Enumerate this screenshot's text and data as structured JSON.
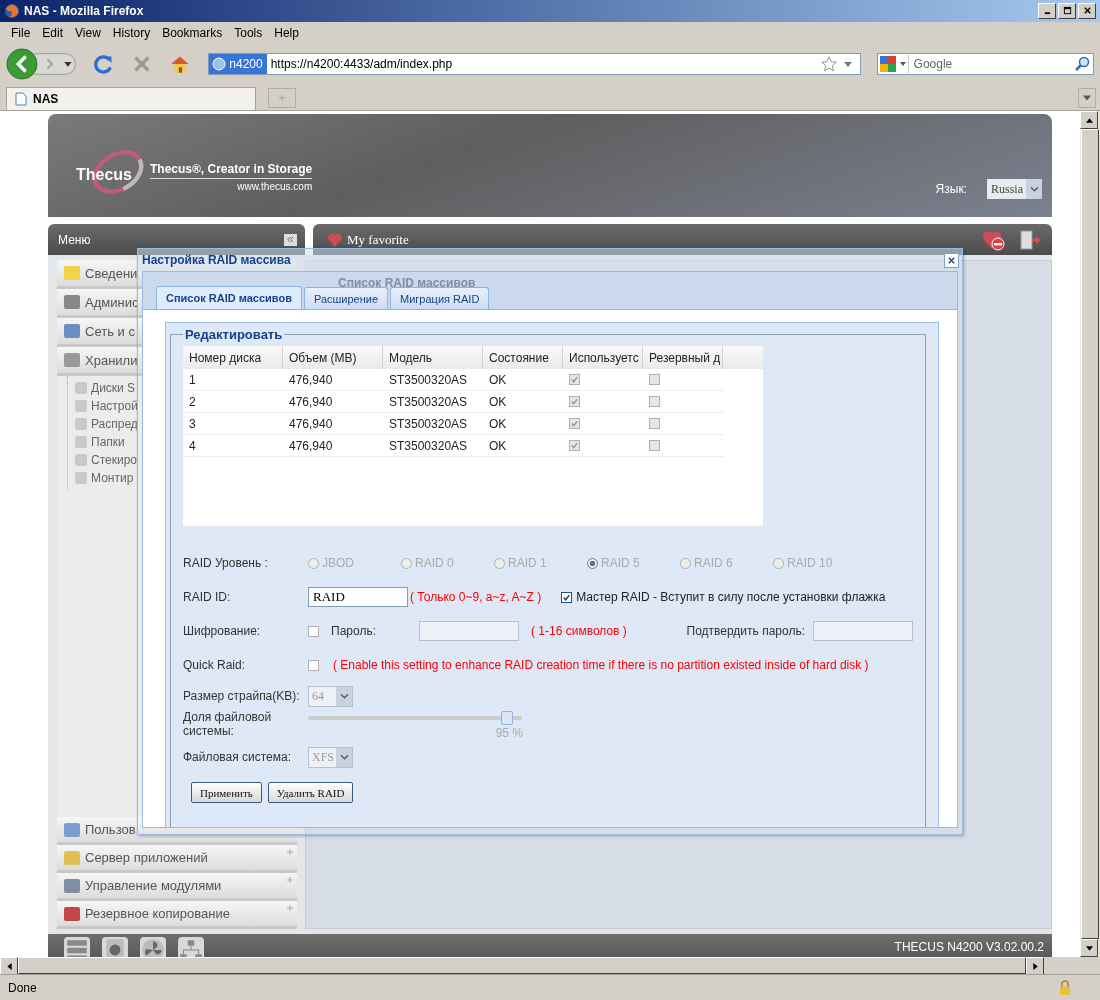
{
  "browser": {
    "title": "NAS - Mozilla Firefox",
    "menu": [
      "File",
      "Edit",
      "View",
      "History",
      "Bookmarks",
      "Tools",
      "Help"
    ],
    "site_badge": "n4200",
    "url": "https://n4200:4433/adm/index.php",
    "search_placeholder": "Google",
    "tabs": [
      {
        "label": "NAS",
        "selected": true
      }
    ],
    "status": "Done"
  },
  "header": {
    "logo": "Thecus",
    "tagline": "Thecus®, Creator in Storage",
    "website": "www.thecus.com",
    "language_label": "Язык:",
    "language": "Russia"
  },
  "menu_bar": {
    "title": "Меню"
  },
  "favorite_bar": {
    "title": "My favorite"
  },
  "sidebar": {
    "upper": [
      {
        "label": "Сведени"
      },
      {
        "label": "Админис"
      },
      {
        "label": "Сеть и с"
      },
      {
        "label": "Хранили",
        "children": [
          "Диски S",
          "Настрой",
          "Распред",
          "Папки",
          "Стекиро",
          "Монтир"
        ]
      }
    ],
    "lower": [
      {
        "label": "Пользов"
      },
      {
        "label": "Сервер приложений"
      },
      {
        "label": "Управление модулями"
      },
      {
        "label": "Резервное копирование"
      }
    ]
  },
  "background_panel": {
    "title": "Список RAID массивов"
  },
  "dialog": {
    "title": "Настройка RAID массива",
    "tabs": [
      {
        "label": "Список RAID массивов",
        "selected": true
      },
      {
        "label": "Расширение",
        "selected": false
      },
      {
        "label": "Миграция RAID",
        "selected": false
      }
    ],
    "legend": "Редактировать",
    "disk_table": {
      "columns": [
        "Номер диска",
        "Объем (MB)",
        "Модель",
        "Состояние",
        "Используетс",
        "Резервный д"
      ],
      "rows": [
        {
          "cells": [
            "1",
            "476,940",
            "ST3500320AS",
            "OK"
          ],
          "used": true,
          "spare": false
        },
        {
          "cells": [
            "2",
            "476,940",
            "ST3500320AS",
            "OK"
          ],
          "used": true,
          "spare": false
        },
        {
          "cells": [
            "3",
            "476,940",
            "ST3500320AS",
            "OK"
          ],
          "used": true,
          "spare": false
        },
        {
          "cells": [
            "4",
            "476,940",
            "ST3500320AS",
            "OK"
          ],
          "used": true,
          "spare": false
        }
      ]
    },
    "raid_level": {
      "label": "RAID Уровень :",
      "options": [
        {
          "label": "JBOD",
          "selected": false
        },
        {
          "label": "RAID 0",
          "selected": false
        },
        {
          "label": "RAID 1",
          "selected": false
        },
        {
          "label": "RAID 5",
          "selected": true
        },
        {
          "label": "RAID 6",
          "selected": false
        },
        {
          "label": "RAID 10",
          "selected": false
        }
      ]
    },
    "raid_id": {
      "label": "RAID ID:",
      "value": "RAID",
      "hint": "( Только 0~9, a~z, A~Z )"
    },
    "master_raid": {
      "label": "Мастер RAID - Вступит в силу после установки флажка",
      "checked": true
    },
    "encryption": {
      "label": "Шифрование:",
      "checked": false,
      "password_label": "Пароль:",
      "hint": "( 1-16 символов )",
      "confirm_label": "Подтвердить пароль:"
    },
    "quick_raid": {
      "label": "Quick Raid:",
      "checked": false,
      "hint": "( Enable this setting to enhance RAID creation time if there is no partition existed inside of hard disk )"
    },
    "stripe_size": {
      "label": "Размер страйпа(KB):",
      "value": "64"
    },
    "fs_share": {
      "label": "Доля файловой системы:",
      "level": 0.93,
      "reading": "95 %"
    },
    "filesystem": {
      "label": "Файловая система:",
      "value": "XFS"
    },
    "buttons": [
      "Применить",
      "Удалить RAID"
    ]
  },
  "footer": {
    "version": "THECUS N4200 V3.02.00.2"
  }
}
